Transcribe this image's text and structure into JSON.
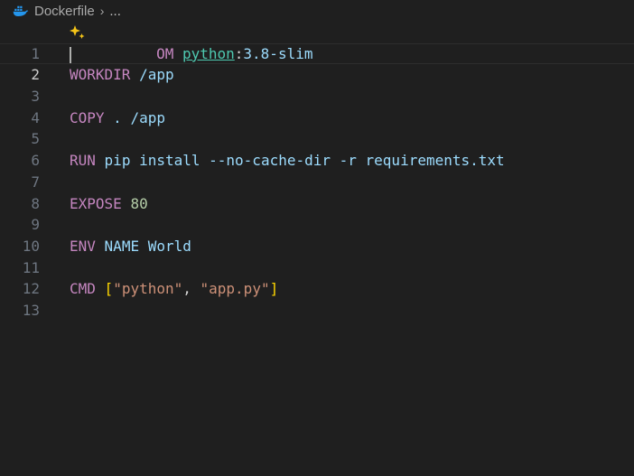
{
  "breadcrumb": {
    "file": "Dockerfile",
    "separator": "›",
    "ellipsis": "..."
  },
  "editor": {
    "current_line": 2,
    "line_numbers": [
      "1",
      "2",
      "3",
      "4",
      "5",
      "6",
      "7",
      "8",
      "9",
      "10",
      "11",
      "12",
      "13"
    ],
    "line1": {
      "kw_tail": "OM",
      "image": "python",
      "colon": ":",
      "tag": "3.8-slim"
    },
    "line3": {
      "kw": "WORKDIR",
      "rest": "/app"
    },
    "line5": {
      "kw": "COPY",
      "rest": ". /app"
    },
    "line7": {
      "kw": "RUN",
      "rest": "pip install --no-cache-dir -r requirements.txt"
    },
    "line9": {
      "kw": "EXPOSE",
      "rest": "80"
    },
    "line11": {
      "kw": "ENV",
      "name": "NAME",
      "value": "World"
    },
    "line13": {
      "kw": "CMD",
      "open": "[",
      "arg1": "\"python\"",
      "comma": ", ",
      "arg2": "\"app.py\"",
      "close": "]"
    }
  },
  "colors": {
    "background": "#1f1f1f",
    "keyword": "#c586c0",
    "variable": "#9cdcfe",
    "image": "#4ec9b0",
    "number": "#b5cea8",
    "string": "#ce9178",
    "bracket": "#ffd700",
    "line_number": "#6e7681"
  },
  "icons": {
    "file_icon": "docker-whale-icon",
    "inline_chat": "sparkle-icon"
  }
}
